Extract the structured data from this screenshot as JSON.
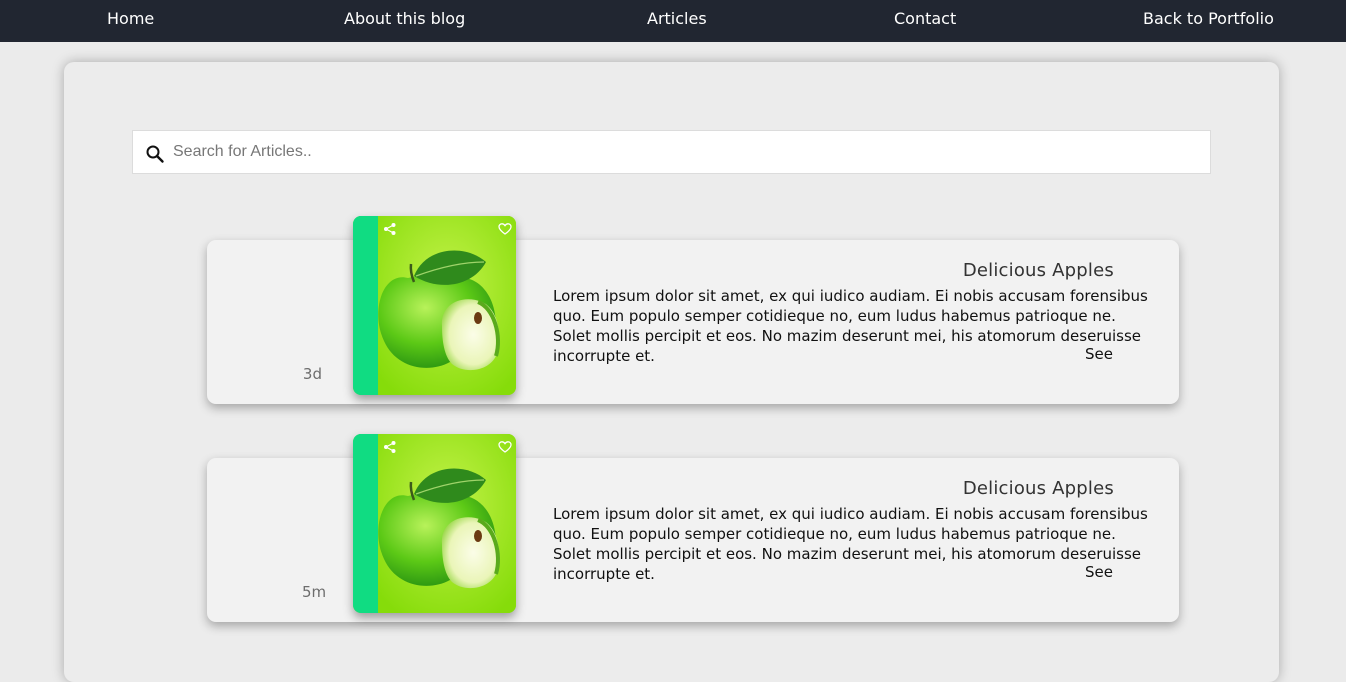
{
  "nav": {
    "items": [
      {
        "label": "Home"
      },
      {
        "label": "About this blog"
      },
      {
        "label": "Articles"
      },
      {
        "label": "Contact"
      },
      {
        "label": "Back to Portfolio"
      }
    ]
  },
  "search": {
    "placeholder": "Search for Articles..",
    "icon": "search-icon"
  },
  "articles": [
    {
      "time": "3d",
      "title": "Delicious Apples",
      "text": "Lorem ipsum dolor sit amet, ex qui iudico audiam. Ei nobis accusam forensibus quo. Eum populo semper cotidieque no, eum ludus habemus patrioque ne. Solet mollis percipit et eos. No mazim deserunt mei, his atomorum deseruisse incorrupte et.",
      "see_label": "See",
      "image": "green-apple-image",
      "icons": [
        "share-icon",
        "heart-icon"
      ]
    },
    {
      "time": "5m",
      "title": "Delicious Apples",
      "text": "Lorem ipsum dolor sit amet, ex qui iudico audiam. Ei nobis accusam forensibus quo. Eum populo semper cotidieque no, eum ludus habemus patrioque ne. Solet mollis percipit et eos. No mazim deserunt mei, his atomorum deseruisse incorrupte et.",
      "see_label": "See",
      "image": "green-apple-image",
      "icons": [
        "share-icon",
        "heart-icon"
      ]
    }
  ],
  "colors": {
    "nav_bg": "#212631",
    "accent_green": "#10dc82",
    "apple_bg": "#8fe30c"
  }
}
